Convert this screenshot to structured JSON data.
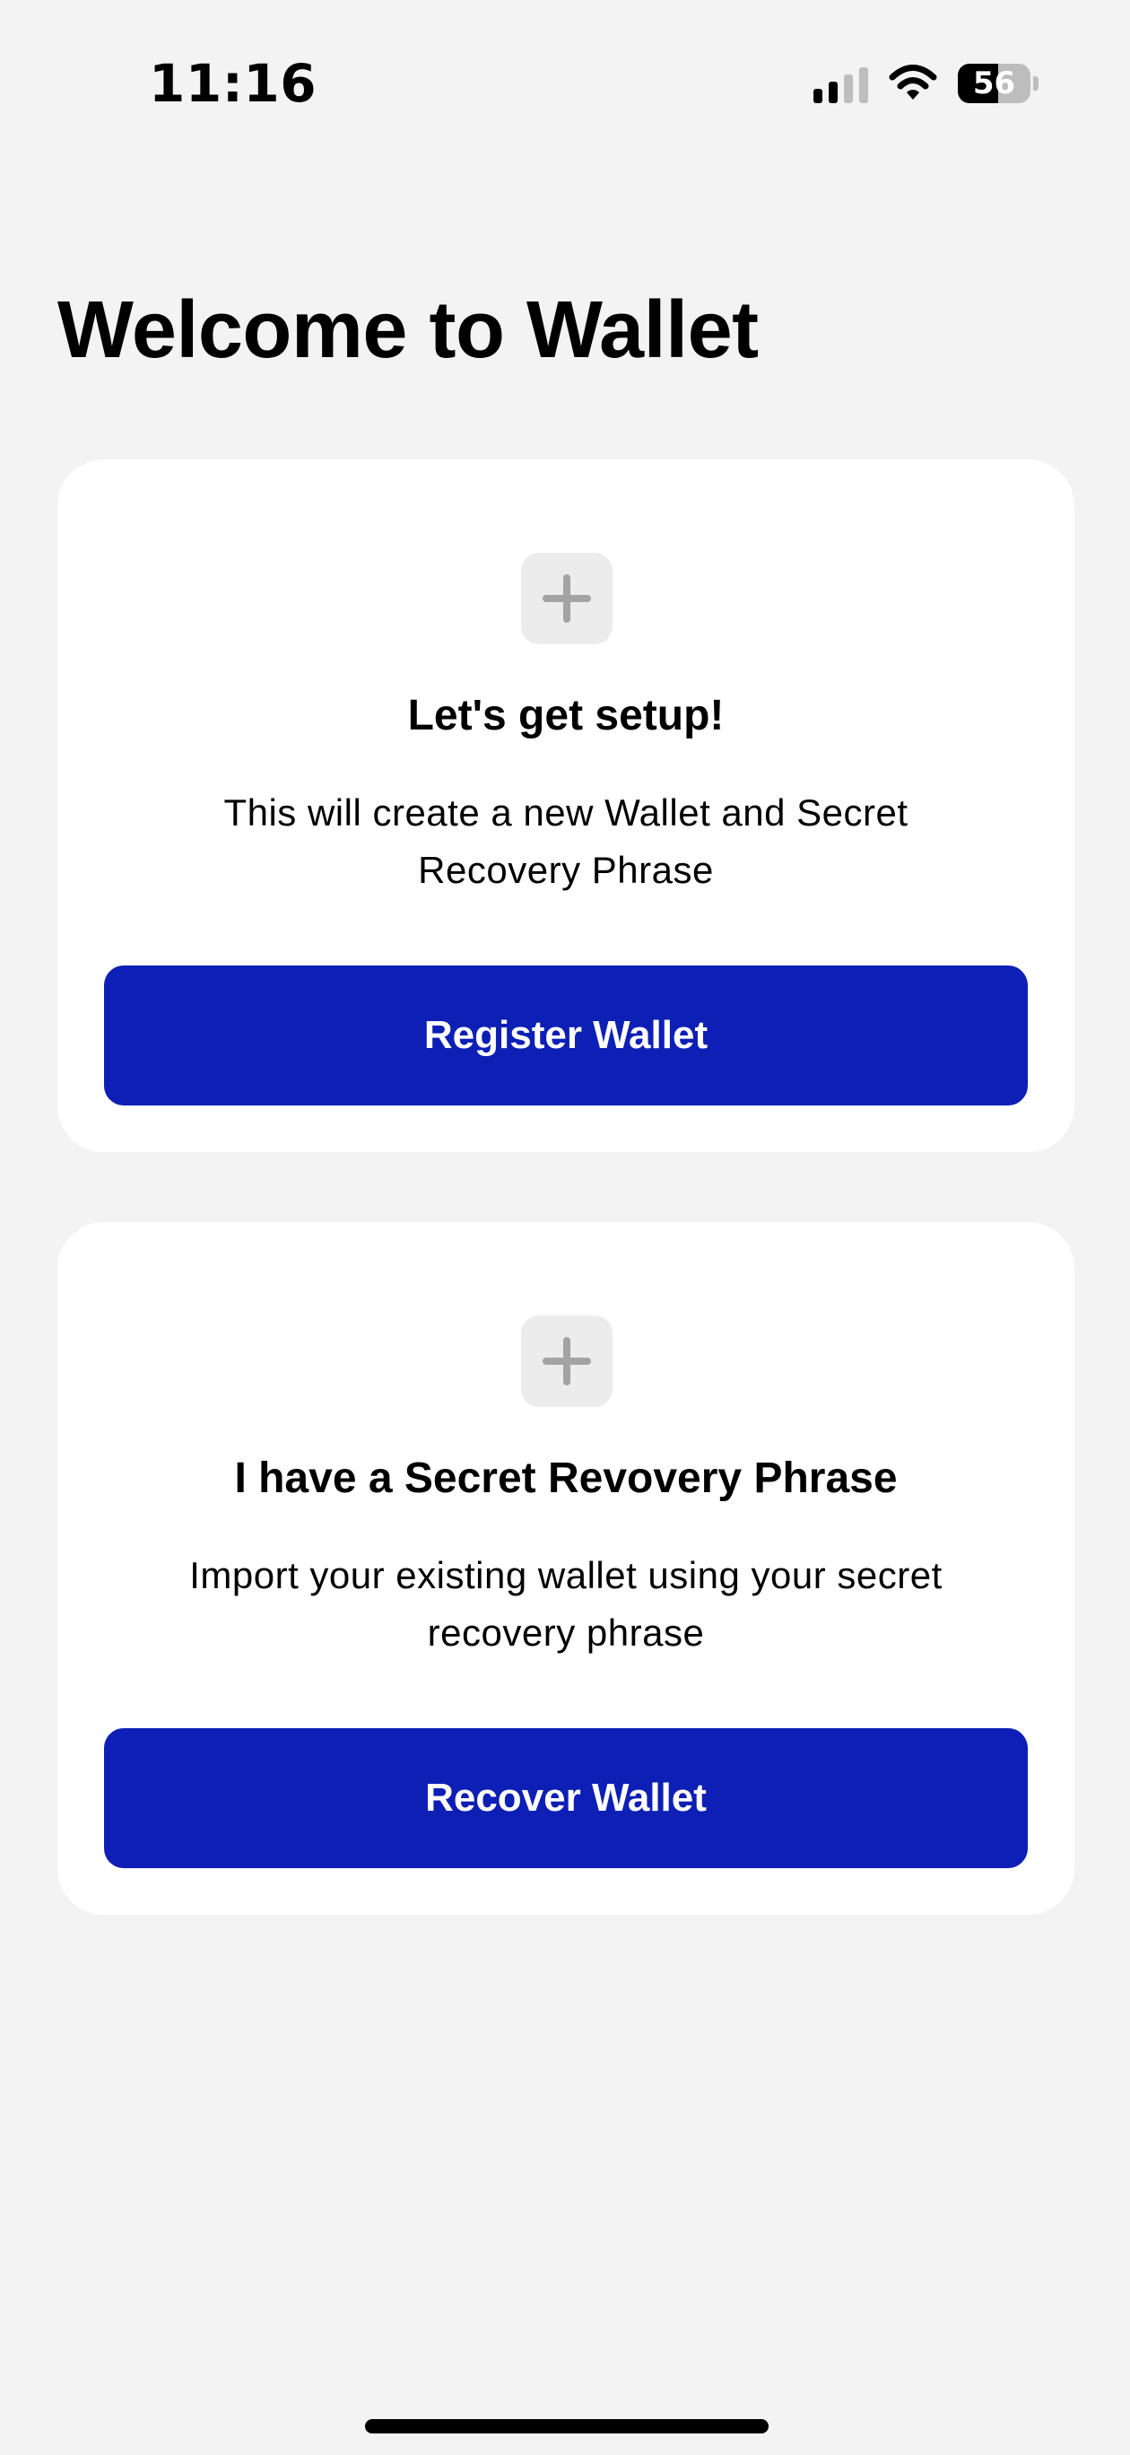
{
  "status_bar": {
    "time": "11:16",
    "battery_level": "56",
    "battery_fraction": 0.56,
    "signal_bars": 2,
    "signal_icon": "cellular-signal-icon",
    "wifi_icon": "wifi-icon",
    "battery_icon": "battery-icon"
  },
  "page": {
    "title": "Welcome to Wallet"
  },
  "cards": {
    "register": {
      "icon": "plus-icon",
      "heading": "Let's get setup!",
      "description": "This will create a new Wallet and Secret Recovery Phrase",
      "button_label": "Register Wallet"
    },
    "recover": {
      "icon": "plus-icon",
      "heading": "I have a Secret Revovery Phrase",
      "description": "Import your existing wallet using your secret recovery phrase",
      "button_label": "Recover Wallet"
    }
  },
  "colors": {
    "background": "#f3f3f3",
    "card": "#ffffff",
    "primary_button": "#0d1fb4",
    "button_text": "#ffffff",
    "icon_tile": "#ececec",
    "icon_glyph": "#a3a3a3"
  }
}
